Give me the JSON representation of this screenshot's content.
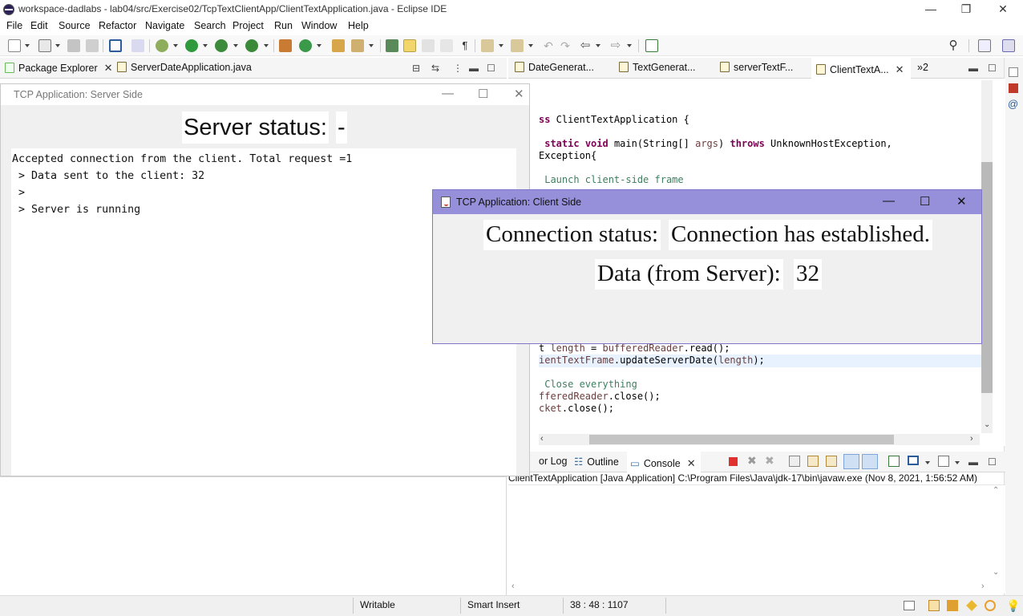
{
  "window": {
    "title": "workspace-dadlabs - lab04/src/Exercise02/TcpTextClientApp/ClientTextApplication.java - Eclipse IDE",
    "minimize_glyph": "—",
    "restore_glyph": "❐",
    "close_glyph": "✕"
  },
  "menu": [
    "File",
    "Edit",
    "Source",
    "Refactor",
    "Navigate",
    "Search",
    "Project",
    "Run",
    "Window",
    "Help"
  ],
  "left_tabs": {
    "package_explorer": "Package Explorer",
    "server_file": "ServerDateApplication.java"
  },
  "editor_tabs": [
    {
      "label": "DateGenerat..."
    },
    {
      "label": "TextGenerat..."
    },
    {
      "label": "serverTextF..."
    },
    {
      "label": "ClientTextA..."
    }
  ],
  "editor_overflow": "»2",
  "code": {
    "line_class": "ss ClientTextApplication {",
    "line_main_1": " static void main(String[] args) throws UnknownHostException,",
    "line_main_2": "Exception{",
    "line_comment_launch": " Launch client-side frame",
    "line_length": "t length = bufferedReader.read();",
    "line_update": "ientTextFrame.updateServerDate(length);",
    "line_comment_close": " Close everything",
    "line_close_reader": "fferedReader.close();",
    "line_close_socket": "cket.close();"
  },
  "console": {
    "tabs": [
      "or Log",
      "Outline",
      "Console"
    ],
    "header": "ClientTextApplication [Java Application] C:\\Program Files\\Java\\jdk-17\\bin\\javaw.exe  (Nov 8, 2021, 1:56:52 AM)"
  },
  "status": {
    "writable": "Writable",
    "insert_mode": "Smart Insert",
    "position": "38 : 48 : 1107"
  },
  "server_window": {
    "title": "TCP Application: Server Side",
    "status_label": "Server status: ",
    "status_value": "-",
    "log": [
      "Accepted connection from the client. Total request =1",
      " > Data sent to the client: 32",
      " >",
      " > Server is running"
    ]
  },
  "client_window": {
    "title": "TCP Application: Client Side",
    "connection_label": "Connection status: ",
    "connection_value": "Connection has established.",
    "data_label": "Data (from Server): ",
    "data_value": "32"
  },
  "colors": {
    "client_titlebar": "#9590d9",
    "keyword": "#7f0055",
    "comment": "#3f7f5f",
    "terminate_red": "#e03030"
  }
}
